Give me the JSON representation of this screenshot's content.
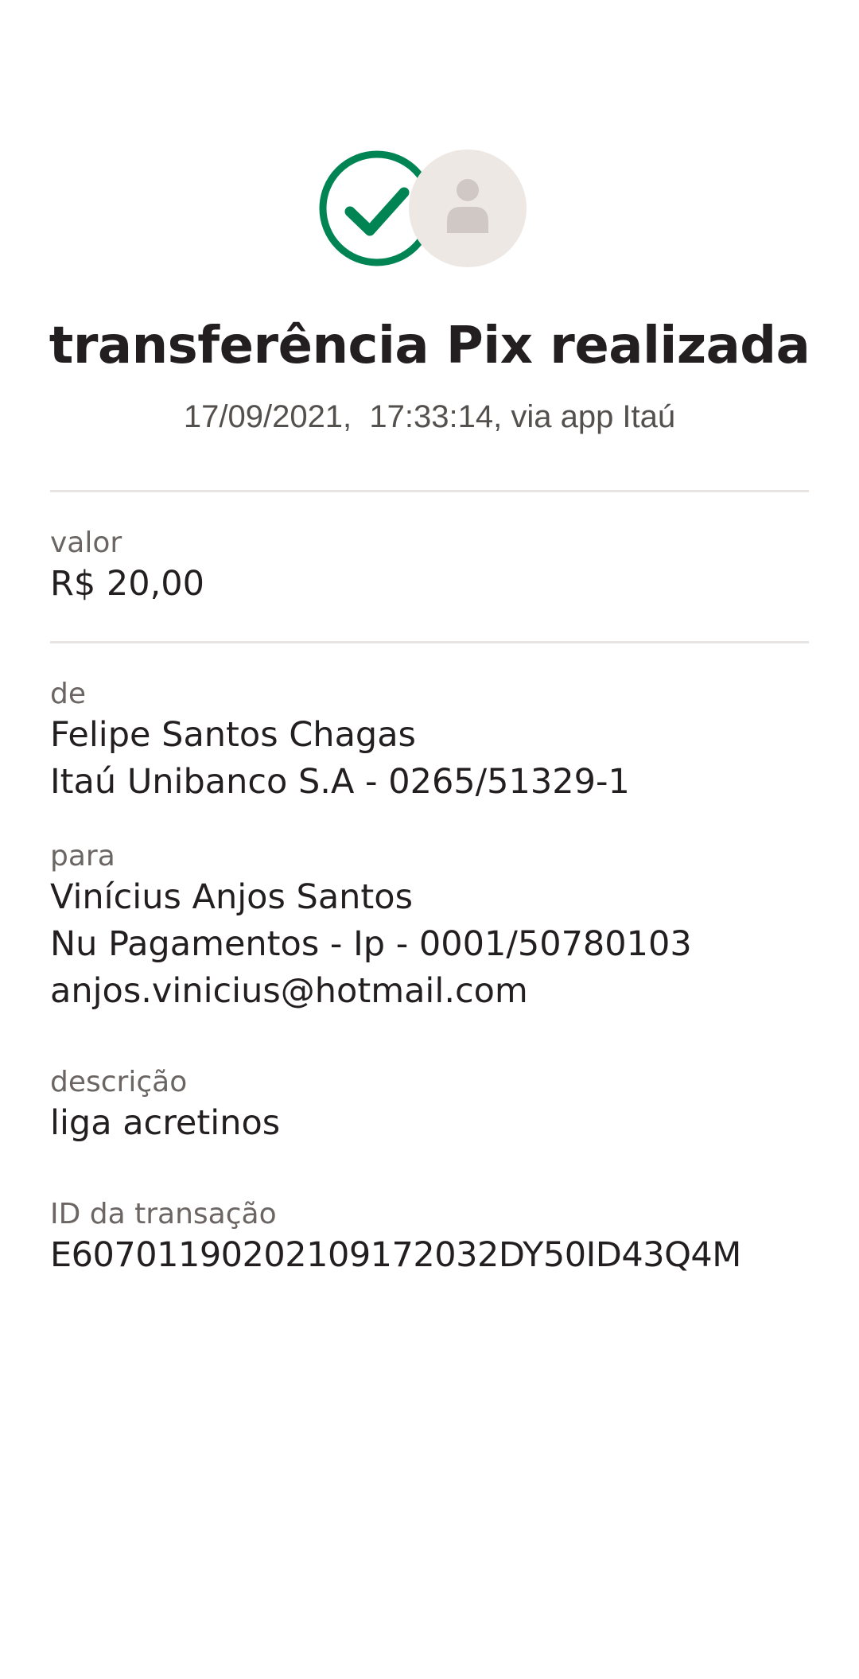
{
  "colors": {
    "success_green": "#008454",
    "avatar_bg": "#ede8e4",
    "avatar_figure": "#cfc8c4",
    "text_primary": "#231f20",
    "text_secondary": "#6b6663",
    "divider": "#e8e4e1"
  },
  "header": {
    "status_icon": "check-circle-icon",
    "avatar_icon": "user-placeholder-icon",
    "title": "transferência Pix realizada",
    "subtitle": "17/09/2021,  17:33:14, via app Itaú"
  },
  "amount": {
    "label": "valor",
    "value": "R$ 20,00"
  },
  "from": {
    "label": "de",
    "name": "Felipe Santos Chagas",
    "account": "Itaú Unibanco S.A - 0265/51329-1"
  },
  "to": {
    "label": "para",
    "name": "Vinícius Anjos Santos",
    "account": "Nu Pagamentos - Ip - 0001/50780103",
    "key": "anjos.vinicius@hotmail.com"
  },
  "description": {
    "label": "descrição",
    "value": "liga acretinos"
  },
  "transaction": {
    "label": "ID da transação",
    "value": "E60701190202109172032DY50ID43Q4M"
  }
}
